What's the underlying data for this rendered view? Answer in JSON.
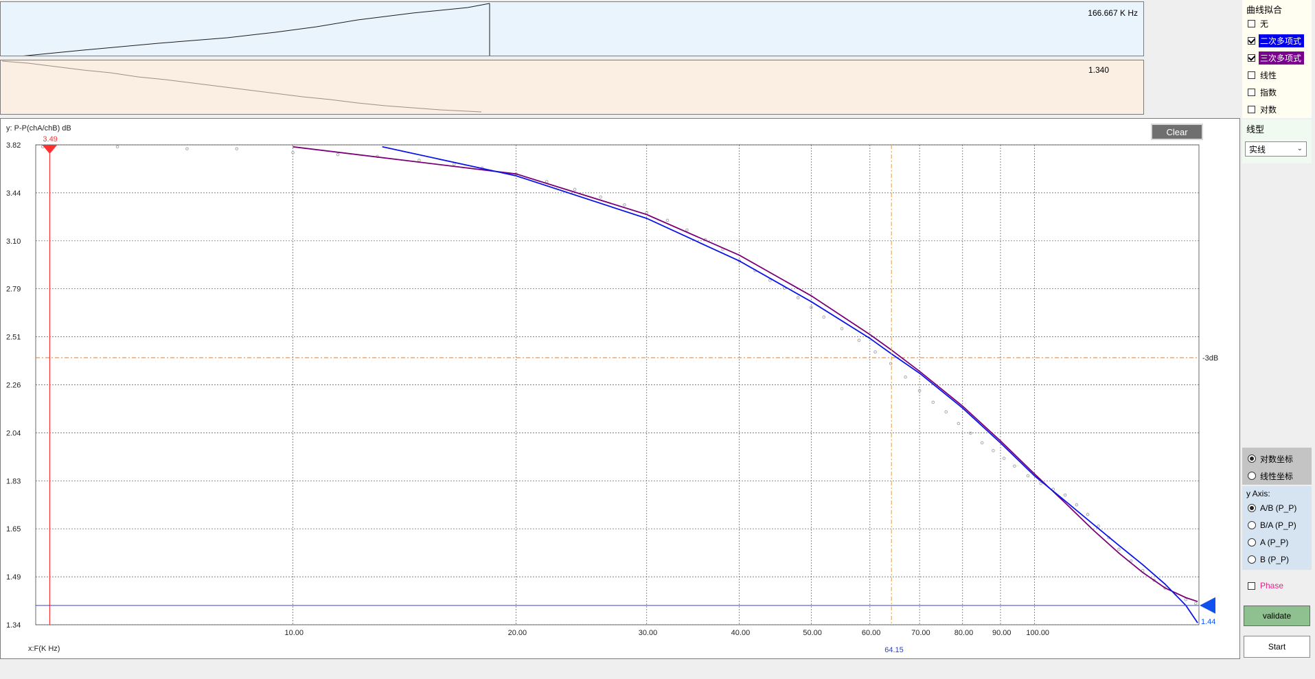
{
  "freq_strip": {
    "value": "166.667 K Hz"
  },
  "ratio_strip": {
    "value": "1.340"
  },
  "chart": {
    "clear_label": "Clear",
    "y_axis_title": "y: P-P(chA/chB) dB",
    "x_axis_title": "x:F(K Hz)",
    "cursor_value": "3.49",
    "ref_line_label": "-3dB",
    "marker_x_label": "64.15",
    "marker_y_label": "1.44",
    "colors": {
      "cursor": "#ff3030",
      "ref_line": "#e0782a",
      "marker_v": "#e0a040",
      "marker_h": "#2a3fff",
      "quadratic": "#0a14e8",
      "cubic": "#7a0078",
      "points": "#a8a8a8"
    }
  },
  "chart_data": {
    "type": "scatter",
    "xscale": "log",
    "xlabel": "x:F(K Hz)",
    "ylabel": "y: P-P(chA/chB) dB",
    "ylim": [
      1.34,
      3.82
    ],
    "y_ticks": [
      "3.82",
      "3.44",
      "3.10",
      "2.79",
      "2.51",
      "2.26",
      "2.04",
      "1.83",
      "1.65",
      "1.49",
      "1.34"
    ],
    "x_ticks": [
      10,
      20,
      30,
      40,
      50,
      60,
      70,
      80,
      90,
      100
    ],
    "x_tick_labels": [
      "10.00",
      "20.00",
      "30.00",
      "40.00",
      "50.00",
      "60.00",
      "70.00",
      "80.00",
      "90.00",
      "100.00"
    ],
    "xlim": [
      4.5,
      166.667
    ],
    "cursor_x": 4.7,
    "ref_y": 2.72,
    "marker_x": 64.15,
    "marker_y": 1.44,
    "points": [
      [
        4.6,
        3.81
      ],
      [
        5.8,
        3.81
      ],
      [
        7.2,
        3.8
      ],
      [
        8.4,
        3.8
      ],
      [
        10.0,
        3.78
      ],
      [
        11.5,
        3.77
      ],
      [
        13.0,
        3.76
      ],
      [
        14.8,
        3.74
      ],
      [
        16.5,
        3.72
      ],
      [
        18.0,
        3.7
      ],
      [
        20.0,
        3.67
      ],
      [
        22.0,
        3.63
      ],
      [
        24.0,
        3.59
      ],
      [
        26.0,
        3.55
      ],
      [
        28.0,
        3.51
      ],
      [
        30.0,
        3.47
      ],
      [
        32.0,
        3.43
      ],
      [
        34.0,
        3.38
      ],
      [
        36.0,
        3.33
      ],
      [
        38.0,
        3.28
      ],
      [
        40.0,
        3.22
      ],
      [
        42.0,
        3.17
      ],
      [
        44.0,
        3.12
      ],
      [
        46.0,
        3.08
      ],
      [
        48.0,
        3.03
      ],
      [
        50.0,
        2.98
      ],
      [
        52.0,
        2.93
      ],
      [
        55.0,
        2.87
      ],
      [
        58.0,
        2.81
      ],
      [
        61.0,
        2.75
      ],
      [
        64.0,
        2.69
      ],
      [
        67.0,
        2.62
      ],
      [
        70.0,
        2.55
      ],
      [
        73.0,
        2.49
      ],
      [
        76.0,
        2.44
      ],
      [
        79.0,
        2.38
      ],
      [
        82.0,
        2.33
      ],
      [
        85.0,
        2.28
      ],
      [
        88.0,
        2.24
      ],
      [
        91.0,
        2.2
      ],
      [
        94.0,
        2.16
      ],
      [
        98.0,
        2.11
      ],
      [
        102.0,
        2.07
      ],
      [
        106.0,
        2.04
      ],
      [
        110.0,
        2.01
      ],
      [
        114.0,
        1.96
      ],
      [
        118.0,
        1.91
      ],
      [
        122.0,
        1.85
      ],
      [
        126.0,
        1.79
      ],
      [
        130.0,
        1.73
      ],
      [
        135.0,
        1.67
      ],
      [
        140.0,
        1.62
      ],
      [
        145.0,
        1.57
      ],
      [
        150.0,
        1.53
      ],
      [
        155.0,
        1.5
      ],
      [
        160.0,
        1.47
      ],
      [
        165.0,
        1.45
      ]
    ],
    "series": [
      {
        "type": "line",
        "values": [
          [
            13.2,
            3.81
          ],
          [
            20.0,
            3.66
          ],
          [
            30.0,
            3.44
          ],
          [
            40.0,
            3.22
          ],
          [
            50.0,
            3.01
          ],
          [
            60.0,
            2.82
          ],
          [
            64.15,
            2.74
          ],
          [
            70.0,
            2.64
          ],
          [
            80.0,
            2.46
          ],
          [
            90.0,
            2.28
          ],
          [
            100.0,
            2.11
          ],
          [
            110.0,
            1.98
          ],
          [
            120.0,
            1.86
          ],
          [
            130.0,
            1.75
          ],
          [
            140.0,
            1.65
          ],
          [
            150.0,
            1.55
          ],
          [
            160.0,
            1.44
          ],
          [
            166.0,
            1.35
          ]
        ]
      },
      {
        "type": "line",
        "values": [
          [
            10.0,
            3.81
          ],
          [
            20.0,
            3.67
          ],
          [
            30.0,
            3.46
          ],
          [
            40.0,
            3.25
          ],
          [
            50.0,
            3.04
          ],
          [
            60.0,
            2.84
          ],
          [
            64.15,
            2.76
          ],
          [
            70.0,
            2.65
          ],
          [
            80.0,
            2.47
          ],
          [
            90.0,
            2.29
          ],
          [
            100.0,
            2.12
          ],
          [
            110.0,
            1.97
          ],
          [
            120.0,
            1.83
          ],
          [
            130.0,
            1.71
          ],
          [
            140.0,
            1.61
          ],
          [
            150.0,
            1.53
          ],
          [
            160.0,
            1.48
          ],
          [
            166.0,
            1.46
          ]
        ]
      }
    ]
  },
  "fit_panel": {
    "title": "曲线拟合",
    "options": [
      {
        "label": "无",
        "checked": false
      },
      {
        "label": "二次多项式",
        "checked": true
      },
      {
        "label": "三次多项式",
        "checked": true
      },
      {
        "label": "线性",
        "checked": false
      },
      {
        "label": "指数",
        "checked": false
      },
      {
        "label": "对数",
        "checked": false
      }
    ]
  },
  "linetype_panel": {
    "title": "线型",
    "selected": "实线"
  },
  "axis_mode": {
    "options": [
      {
        "label": "对数坐标",
        "checked": true
      },
      {
        "label": "线性坐标",
        "checked": false
      }
    ]
  },
  "yaxis_panel": {
    "title": "y Axis:",
    "options": [
      {
        "label": "A/B (P_P)",
        "checked": true
      },
      {
        "label": "B/A (P_P)",
        "checked": false
      },
      {
        "label": "A (P_P)",
        "checked": false
      },
      {
        "label": "B (P_P)",
        "checked": false
      }
    ]
  },
  "phase": {
    "label": "Phase",
    "checked": false,
    "color": "#e8208a"
  },
  "buttons": {
    "validate": "validate",
    "start": "Start"
  }
}
